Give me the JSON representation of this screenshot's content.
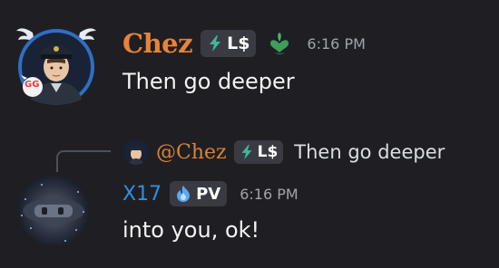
{
  "message1": {
    "author": "Chez",
    "tag": "L$",
    "timestamp": "6:16 PM",
    "content": "Then go deeper",
    "author_color": "#e8833a"
  },
  "reply": {
    "mention": "@Chez",
    "tag": "L$",
    "content": "Then go deeper"
  },
  "message2": {
    "author": "X17",
    "tag": "PV",
    "timestamp": "6:16 PM",
    "content": "into you, ok!",
    "author_color": "#2f8fe0"
  },
  "avatar_badge_text": "GG",
  "icons": {
    "tag_icon": "lightning-bolt-icon",
    "role_icon": "heart-leaf-icon",
    "pv_icon": "blue-flame-icon"
  }
}
